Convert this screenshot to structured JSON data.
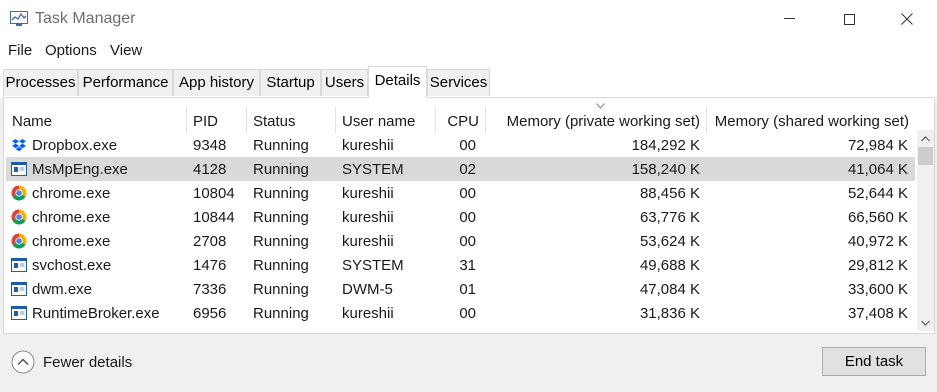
{
  "window": {
    "title": "Task Manager"
  },
  "menu": [
    "File",
    "Options",
    "View"
  ],
  "tabs": [
    {
      "label": "Processes",
      "active": false
    },
    {
      "label": "Performance",
      "active": false
    },
    {
      "label": "App history",
      "active": false
    },
    {
      "label": "Startup",
      "active": false
    },
    {
      "label": "Users",
      "active": false
    },
    {
      "label": "Details",
      "active": true
    },
    {
      "label": "Services",
      "active": false
    }
  ],
  "table": {
    "columns": [
      "Name",
      "PID",
      "Status",
      "User name",
      "CPU",
      "Memory (private working set)",
      "Memory (shared working set)"
    ],
    "sorted_column": "Memory (private working set)",
    "rows": [
      {
        "name": "Dropbox.exe",
        "icon": "dropbox-icon",
        "pid": "9348",
        "status": "Running",
        "user": "kureshii",
        "cpu": "00",
        "mem_private": "184,292 K",
        "mem_shared": "72,984 K",
        "selected": false
      },
      {
        "name": "MsMpEng.exe",
        "icon": "system-process-icon",
        "pid": "4128",
        "status": "Running",
        "user": "SYSTEM",
        "cpu": "02",
        "mem_private": "158,240 K",
        "mem_shared": "41,064 K",
        "selected": true
      },
      {
        "name": "chrome.exe",
        "icon": "chrome-icon",
        "pid": "10804",
        "status": "Running",
        "user": "kureshii",
        "cpu": "00",
        "mem_private": "88,456 K",
        "mem_shared": "52,644 K",
        "selected": false
      },
      {
        "name": "chrome.exe",
        "icon": "chrome-icon",
        "pid": "10844",
        "status": "Running",
        "user": "kureshii",
        "cpu": "00",
        "mem_private": "63,776 K",
        "mem_shared": "66,560 K",
        "selected": false
      },
      {
        "name": "chrome.exe",
        "icon": "chrome-icon",
        "pid": "2708",
        "status": "Running",
        "user": "kureshii",
        "cpu": "00",
        "mem_private": "53,624 K",
        "mem_shared": "40,972 K",
        "selected": false
      },
      {
        "name": "svchost.exe",
        "icon": "system-process-icon",
        "pid": "1476",
        "status": "Running",
        "user": "SYSTEM",
        "cpu": "31",
        "mem_private": "49,688 K",
        "mem_shared": "29,812 K",
        "selected": false
      },
      {
        "name": "dwm.exe",
        "icon": "system-process-icon",
        "pid": "7336",
        "status": "Running",
        "user": "DWM-5",
        "cpu": "01",
        "mem_private": "47,084 K",
        "mem_shared": "33,600 K",
        "selected": false
      },
      {
        "name": "RuntimeBroker.exe",
        "icon": "system-process-icon",
        "pid": "6956",
        "status": "Running",
        "user": "kureshii",
        "cpu": "00",
        "mem_private": "31,836 K",
        "mem_shared": "37,408 K",
        "selected": false
      }
    ]
  },
  "footer": {
    "fewer_details": "Fewer details",
    "end_task": "End task"
  },
  "colors": {
    "selected_row": "#d9d9d9",
    "chrome_red": "#db4437",
    "chrome_green": "#0f9d58",
    "chrome_yellow": "#f4b400",
    "chrome_blue": "#4285f4",
    "dropbox_blue": "#0061fe",
    "process_icon_blue": "#1f5ca8"
  }
}
